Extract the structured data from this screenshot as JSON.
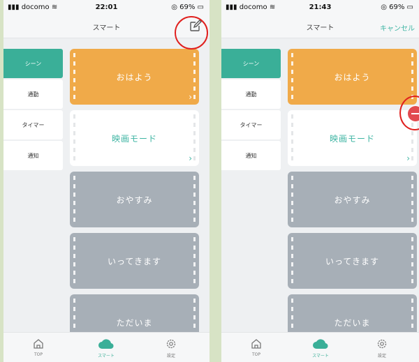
{
  "colors": {
    "accent": "#3aaf98",
    "orange": "#f0aa49",
    "gray": "#a7afb7",
    "white_card": "#ffffff",
    "highlight_ring": "#e0201e",
    "delete": "#e24a4f"
  },
  "screens": [
    {
      "status": {
        "carrier": "docomo",
        "time": "22:01",
        "battery": "69%"
      },
      "nav": {
        "title": "スマート",
        "action_icon": "edit-icon"
      },
      "sidebar": [
        "シーン",
        "通勤",
        "タイマー",
        "通知"
      ],
      "cards": [
        "おはよう",
        "映画モード",
        "おやすみ",
        "いってきます",
        "ただいま"
      ],
      "tabs": [
        "TOP",
        "スマート",
        "設定"
      ]
    },
    {
      "status": {
        "carrier": "docomo",
        "time": "21:43",
        "battery": "69%"
      },
      "nav": {
        "title": "スマート",
        "action_label": "キャンセル"
      },
      "sidebar": [
        "シーン",
        "通勤",
        "タイマー",
        "通知"
      ],
      "cards": [
        "おはよう",
        "映画モード",
        "おやすみ",
        "いってきます",
        "ただいま"
      ],
      "tabs": [
        "TOP",
        "スマート",
        "設定"
      ]
    }
  ]
}
